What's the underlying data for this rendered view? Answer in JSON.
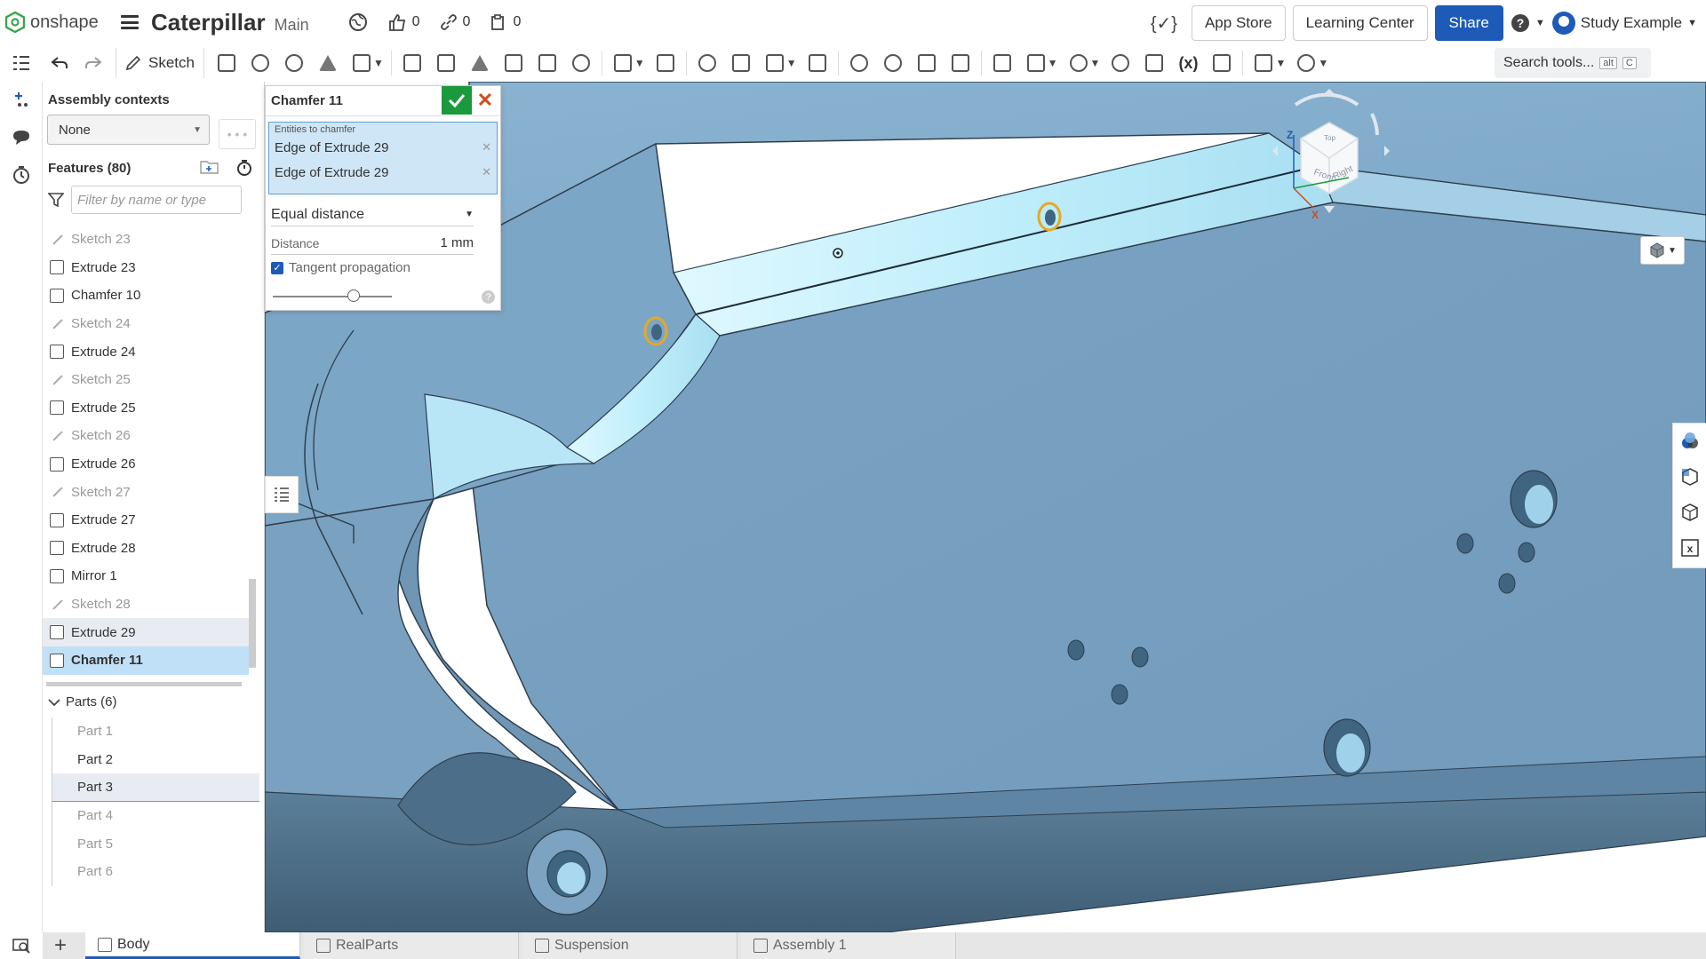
{
  "header": {
    "brand": "onshape",
    "title": "Caterpillar",
    "branch": "Main",
    "likes": "0",
    "links": "0",
    "copies": "0",
    "app_store": "App Store",
    "learning_center": "Learning Center",
    "share": "Share",
    "variable_symbol": "{✓}",
    "user": "Study Example"
  },
  "toolbar": {
    "sketch_label": "Sketch",
    "search_placeholder": "Search tools...",
    "search_shortcut_1": "alt",
    "search_shortcut_2": "C"
  },
  "panel": {
    "assembly_contexts_title": "Assembly contexts",
    "assembly_context_value": "None",
    "features_title": "Features (80)",
    "filter_placeholder": "Filter by name or type",
    "features": [
      {
        "label": "Sketch 23",
        "type": "sketch"
      },
      {
        "label": "Extrude 23",
        "type": "extrude"
      },
      {
        "label": "Chamfer 10",
        "type": "chamfer"
      },
      {
        "label": "Sketch 24",
        "type": "sketch"
      },
      {
        "label": "Extrude 24",
        "type": "extrude"
      },
      {
        "label": "Sketch 25",
        "type": "sketch"
      },
      {
        "label": "Extrude 25",
        "type": "extrude"
      },
      {
        "label": "Sketch 26",
        "type": "sketch"
      },
      {
        "label": "Extrude 26",
        "type": "extrude"
      },
      {
        "label": "Sketch 27",
        "type": "sketch"
      },
      {
        "label": "Extrude 27",
        "type": "extrude"
      },
      {
        "label": "Extrude 28",
        "type": "extrude"
      },
      {
        "label": "Mirror 1",
        "type": "mirror"
      },
      {
        "label": "Sketch 28",
        "type": "sketch"
      },
      {
        "label": "Extrude 29",
        "type": "extrude"
      },
      {
        "label": "Chamfer 11",
        "type": "chamfer"
      }
    ],
    "parts_title": "Parts (6)",
    "parts": [
      "Part 1",
      "Part 2",
      "Part 3",
      "Part 4",
      "Part 5",
      "Part 6"
    ]
  },
  "dialog": {
    "title": "Chamfer 11",
    "entities_label": "Entities to chamfer",
    "entities": [
      "Edge of Extrude 29",
      "Edge of Extrude 29"
    ],
    "measure_type": "Equal distance",
    "distance_label": "Distance",
    "distance_value": "1 mm",
    "tangent_label": "Tangent propagation",
    "tangent_checked": true,
    "help": "?"
  },
  "viewcube": {
    "front": "Front",
    "right": "Right",
    "top": "Top",
    "axis_z": "Z",
    "axis_x": "X"
  },
  "tabs": [
    {
      "label": "Body",
      "active": true
    },
    {
      "label": "RealParts",
      "active": false
    },
    {
      "label": "Suspension",
      "active": false
    },
    {
      "label": "Assembly 1",
      "active": false
    }
  ],
  "colors": {
    "accent": "#1e5bb8",
    "confirm": "#1a9a3c",
    "cancel": "#d14b1d",
    "model_face": "#7da7c8",
    "model_highlight": "#bfeefb",
    "selection": "#bfe0f6"
  }
}
